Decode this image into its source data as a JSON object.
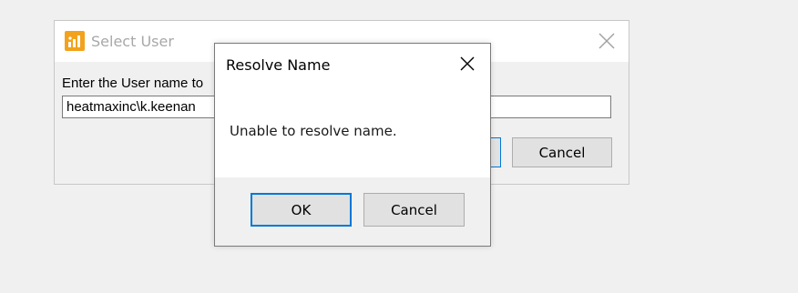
{
  "background_window": {
    "title": "Select User",
    "app_icon": "bar-chart-icon",
    "prompt": "Enter the User name to",
    "input_value": "heatmaxinc\\k.keenan",
    "cancel_label": "Cancel",
    "close_icon": "close-icon"
  },
  "modal": {
    "title": "Resolve Name",
    "message": "Unable to resolve name.",
    "ok_label": "OK",
    "cancel_label": "Cancel",
    "close_icon": "close-icon"
  },
  "colors": {
    "accent": "#0078d7",
    "app_icon": "#f2a21b",
    "button_face": "#e1e1e1",
    "window_bg": "#f0f0f0"
  }
}
